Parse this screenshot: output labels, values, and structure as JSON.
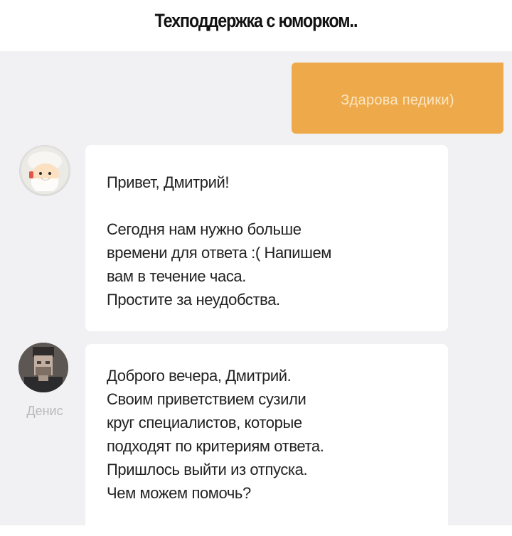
{
  "caption": "Техподдержка с юморком..",
  "user_message": "Здарова педики)",
  "messages": [
    {
      "greeting": "Привет, Дмитрий!",
      "lines": [
        "Сегодня нам нужно больше",
        "времени для ответа :( Напишем",
        "вам в течение часа.",
        "Простите за неудобства."
      ]
    },
    {
      "agent_name": "Денис",
      "lines": [
        "Доброго вечера, Дмитрий.",
        "Своим приветствием сузили",
        "круг специалистов, которые",
        "подходят по критериям ответа.",
        "Пришлось выйти из отпуска.",
        "Чем можем помочь?"
      ]
    }
  ],
  "colors": {
    "user_bubble": "#eeaa4a",
    "chat_background": "#f1f1f3"
  }
}
